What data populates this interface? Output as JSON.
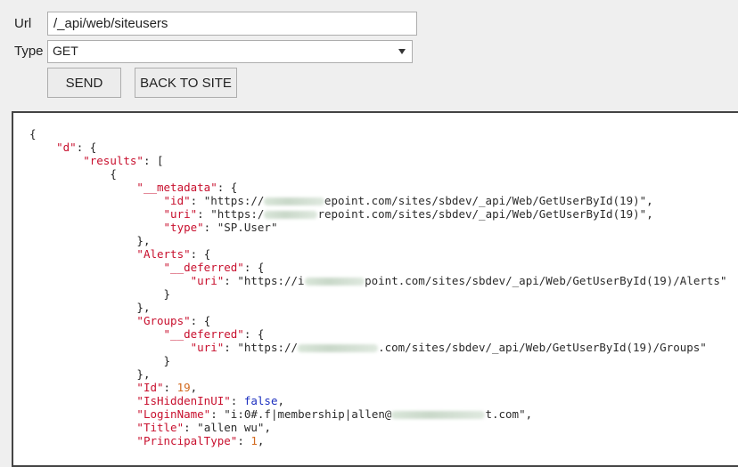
{
  "form": {
    "url_label": "Url",
    "url_value": "/_api/web/siteusers",
    "type_label": "Type",
    "type_value": "GET",
    "send_label": "SEND",
    "back_label": "BACK TO SITE"
  },
  "response": {
    "lines": [
      {
        "indent": 0,
        "parts": [
          {
            "t": "{",
            "c": "p"
          }
        ]
      },
      {
        "indent": 1,
        "parts": [
          {
            "t": "\"d\"",
            "c": "k"
          },
          {
            "t": ": {",
            "c": "p"
          }
        ]
      },
      {
        "indent": 2,
        "parts": [
          {
            "t": "\"results\"",
            "c": "k"
          },
          {
            "t": ": [",
            "c": "p"
          }
        ]
      },
      {
        "indent": 3,
        "parts": [
          {
            "t": "{",
            "c": "p"
          }
        ]
      },
      {
        "indent": 4,
        "parts": [
          {
            "t": "\"__metadata\"",
            "c": "k"
          },
          {
            "t": ": {",
            "c": "p"
          }
        ]
      },
      {
        "indent": 5,
        "parts": [
          {
            "t": "\"id\"",
            "c": "k"
          },
          {
            "t": ": ",
            "c": "p"
          },
          {
            "t": "\"https://",
            "c": "s"
          },
          {
            "blur": 9
          },
          {
            "t": "epoint.com/sites/sbdev/_api/Web/GetUserById(19)\"",
            "c": "s"
          },
          {
            "t": ",",
            "c": "p"
          }
        ]
      },
      {
        "indent": 5,
        "parts": [
          {
            "t": "\"uri\"",
            "c": "k"
          },
          {
            "t": ": ",
            "c": "p"
          },
          {
            "t": "\"https:/",
            "c": "s"
          },
          {
            "blur": 8
          },
          {
            "t": "repoint.com/sites/sbdev/_api/Web/GetUserById(19)\"",
            "c": "s"
          },
          {
            "t": ",",
            "c": "p"
          }
        ]
      },
      {
        "indent": 5,
        "parts": [
          {
            "t": "\"type\"",
            "c": "k"
          },
          {
            "t": ": ",
            "c": "p"
          },
          {
            "t": "\"SP.User\"",
            "c": "s"
          }
        ]
      },
      {
        "indent": 4,
        "parts": [
          {
            "t": "},",
            "c": "p"
          }
        ]
      },
      {
        "indent": 4,
        "parts": [
          {
            "t": "\"Alerts\"",
            "c": "k"
          },
          {
            "t": ": {",
            "c": "p"
          }
        ]
      },
      {
        "indent": 5,
        "parts": [
          {
            "t": "\"__deferred\"",
            "c": "k"
          },
          {
            "t": ": {",
            "c": "p"
          }
        ]
      },
      {
        "indent": 6,
        "parts": [
          {
            "t": "\"uri\"",
            "c": "k"
          },
          {
            "t": ": ",
            "c": "p"
          },
          {
            "t": "\"https://i",
            "c": "s"
          },
          {
            "blur": 9
          },
          {
            "t": "point.com/sites/sbdev/_api/Web/GetUserById(19)/Alerts\"",
            "c": "s"
          }
        ]
      },
      {
        "indent": 5,
        "parts": [
          {
            "t": "}",
            "c": "p"
          }
        ]
      },
      {
        "indent": 4,
        "parts": [
          {
            "t": "},",
            "c": "p"
          }
        ]
      },
      {
        "indent": 4,
        "parts": [
          {
            "t": "\"Groups\"",
            "c": "k"
          },
          {
            "t": ": {",
            "c": "p"
          }
        ]
      },
      {
        "indent": 5,
        "parts": [
          {
            "t": "\"__deferred\"",
            "c": "k"
          },
          {
            "t": ": {",
            "c": "p"
          }
        ]
      },
      {
        "indent": 6,
        "parts": [
          {
            "t": "\"uri\"",
            "c": "k"
          },
          {
            "t": ": ",
            "c": "p"
          },
          {
            "t": "\"https://",
            "c": "s"
          },
          {
            "blur": 12
          },
          {
            "t": ".com/sites/sbdev/_api/Web/GetUserById(19)/Groups\"",
            "c": "s"
          }
        ]
      },
      {
        "indent": 5,
        "parts": [
          {
            "t": "}",
            "c": "p"
          }
        ]
      },
      {
        "indent": 4,
        "parts": [
          {
            "t": "},",
            "c": "p"
          }
        ]
      },
      {
        "indent": 4,
        "parts": [
          {
            "t": "\"Id\"",
            "c": "k"
          },
          {
            "t": ": ",
            "c": "p"
          },
          {
            "t": "19",
            "c": "n"
          },
          {
            "t": ",",
            "c": "p"
          }
        ]
      },
      {
        "indent": 4,
        "parts": [
          {
            "t": "\"IsHiddenInUI\"",
            "c": "k"
          },
          {
            "t": ": ",
            "c": "p"
          },
          {
            "t": "false",
            "c": "b"
          },
          {
            "t": ",",
            "c": "p"
          }
        ]
      },
      {
        "indent": 4,
        "parts": [
          {
            "t": "\"LoginName\"",
            "c": "k"
          },
          {
            "t": ": ",
            "c": "p"
          },
          {
            "t": "\"i:0#.f|membership|allen@",
            "c": "s"
          },
          {
            "blur": 14
          },
          {
            "t": "t.com\"",
            "c": "s"
          },
          {
            "t": ",",
            "c": "p"
          }
        ]
      },
      {
        "indent": 4,
        "parts": [
          {
            "t": "\"Title\"",
            "c": "k"
          },
          {
            "t": ": ",
            "c": "p"
          },
          {
            "t": "\"allen wu\"",
            "c": "s"
          },
          {
            "t": ",",
            "c": "p"
          }
        ]
      },
      {
        "indent": 4,
        "parts": [
          {
            "t": "\"PrincipalType\"",
            "c": "k"
          },
          {
            "t": ": ",
            "c": "p"
          },
          {
            "t": "1",
            "c": "n"
          },
          {
            "t": ",",
            "c": "p"
          }
        ]
      }
    ]
  }
}
